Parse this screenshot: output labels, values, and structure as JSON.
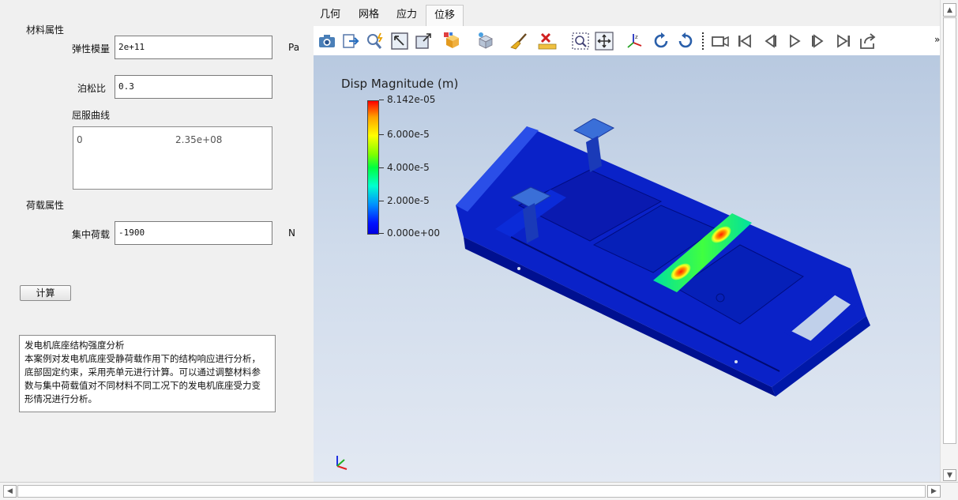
{
  "material": {
    "section_label": "材料属性",
    "elastic_label": "弹性模量",
    "elastic_value": "2e+11",
    "elastic_unit": "Pa",
    "poisson_label": "泊松比",
    "poisson_value": "0.3",
    "yield_label": "屈服曲线",
    "yield_x": "0",
    "yield_y": "2.35e+08"
  },
  "load": {
    "section_label": "荷载属性",
    "force_label": "集中荷载",
    "force_value": "-1900",
    "force_unit": "N"
  },
  "compute_button": "计算",
  "description": "发电机底座结构强度分析\n本案例对发电机底座受静荷载作用下的结构响应进行分析，\n底部固定约束，采用壳单元进行计算。可以通过调整材料参\n数与集中荷载值对不同材料不同工况下的发电机底座受力变\n形情况进行分析。",
  "tabs": [
    {
      "label": "几何"
    },
    {
      "label": "网格"
    },
    {
      "label": "应力"
    },
    {
      "label": "位移",
      "active": true
    }
  ],
  "toolbar": {
    "overflow": "»",
    "icons": [
      "camera-icon",
      "export-icon",
      "zoom-magic-icon",
      "zoom-fit-icon",
      "maximize-icon",
      "view-cube-icon",
      "view-options-icon",
      "clear-brush-icon",
      "ruler-delete-icon",
      "zoom-box-icon",
      "pan-icon",
      "axes-icon",
      "rotate-cw-icon",
      "rotate-ccw-icon",
      "video-camera-icon",
      "first-frame-icon",
      "prev-frame-icon",
      "play-icon",
      "next-frame-icon",
      "last-frame-icon",
      "share-icon"
    ]
  },
  "legend": {
    "title": "Disp Magnitude (m)",
    "ticks": [
      "8.142e-05",
      "6.000e-5",
      "4.000e-5",
      "2.000e-5",
      "0.000e+00"
    ],
    "colors": [
      "#ff0000",
      "#ffff00",
      "#00ff00",
      "#00ffff",
      "#0000ff"
    ]
  },
  "axes_triad": {
    "x_color": "#e02020",
    "y_color": "#20b020",
    "z_color": "#2030e0"
  }
}
